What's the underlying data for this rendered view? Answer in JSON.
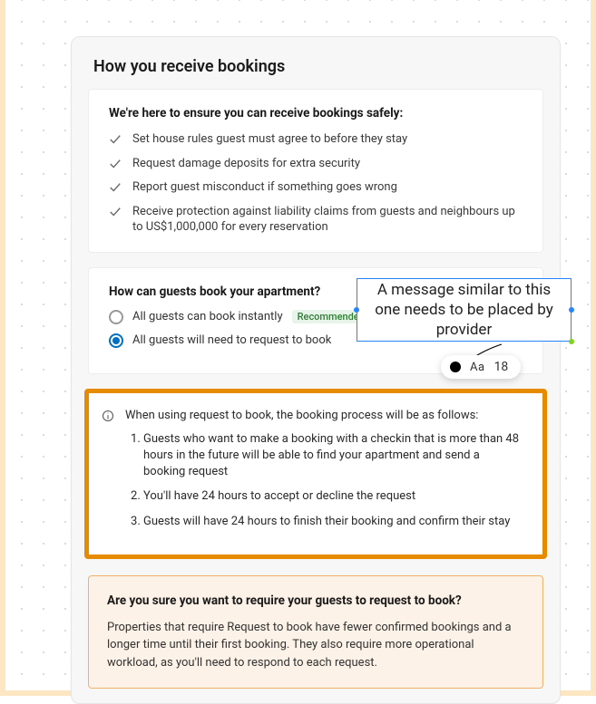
{
  "page_title": "How you receive bookings",
  "safety_panel": {
    "heading": "We're here to ensure you can receive bookings safely:",
    "items": [
      "Set house rules guest must agree to before they stay",
      "Request damage deposits for extra security",
      "Report guest misconduct if something goes wrong",
      "Receive protection against liability claims from guests and neighbours up to US$1,000,000 for every reservation"
    ]
  },
  "booking_question": {
    "heading": "How can guests book your apartment?",
    "option_instant": "All guests can book instantly",
    "badge_recommended": "Recommended",
    "option_request": "All guests will need to request to book",
    "selected": "request"
  },
  "request_info": {
    "intro": "When using request to book, the booking process will be as follows:",
    "steps": [
      "Guests who want to make a booking with a checkin that is more than 48 hours in the future will be able to find your apartment and send a booking request",
      "You'll have 24 hours to accept or decline the request",
      "Guests will have 24 hours to finish their booking and confirm their stay"
    ]
  },
  "warning_panel": {
    "heading": "Are you sure you want to require your guests to request to book?",
    "body": "Properties that require Request to book have fewer confirmed bookings and a longer time until their first booking. They also require more operational workload, as you'll need to respond to each request."
  },
  "annotation": {
    "text": "A message similar to this one needs to be placed by provider",
    "font_label": "Aa",
    "font_size": "18"
  }
}
